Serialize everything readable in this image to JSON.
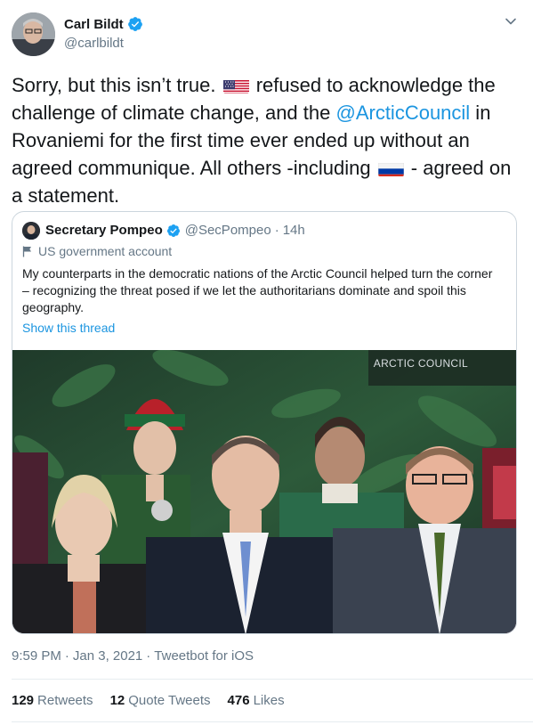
{
  "author": {
    "display_name": "Carl Bildt",
    "handle": "@carlbildt",
    "verified": true,
    "avatar_icon": "profile-photo"
  },
  "tweet": {
    "text_parts": {
      "p1": "Sorry, but this isn’t true. ",
      "flag1_icon": "us-flag",
      "p2": " refused to acknowledge the challenge of climate change, and the ",
      "mention": "@ArcticCouncil",
      "p3": " in Rovaniemi for the first time ever ended up without an agreed communique. All others -including ",
      "flag2_icon": "russia-flag",
      "p4": " - agreed on a statement."
    }
  },
  "quoted": {
    "display_name": "Secretary Pompeo",
    "handle": "@SecPompeo",
    "separator": "·",
    "time": "14h",
    "label": "US government account",
    "text": "My counterparts in the democratic nations of the Arctic Council helped turn the corner – recognizing the threat posed if we let the authoritarians dominate and spoil this geography.",
    "thread_link": "Show this thread",
    "photo_sign": "ARCTIC COUNCIL"
  },
  "meta": {
    "time": "9:59 PM",
    "sep1": "·",
    "date": "Jan 3, 2021",
    "sep2": "·",
    "source": "Tweetbot for iOS"
  },
  "stats": {
    "retweets_count": "129",
    "retweets_label": "Retweets",
    "quotes_count": "12",
    "quotes_label": "Quote Tweets",
    "likes_count": "476",
    "likes_label": "Likes"
  },
  "colors": {
    "link": "#1b95e0",
    "secondary_text": "#657786",
    "primary_text": "#14171a",
    "border": "#ccd6dd"
  }
}
